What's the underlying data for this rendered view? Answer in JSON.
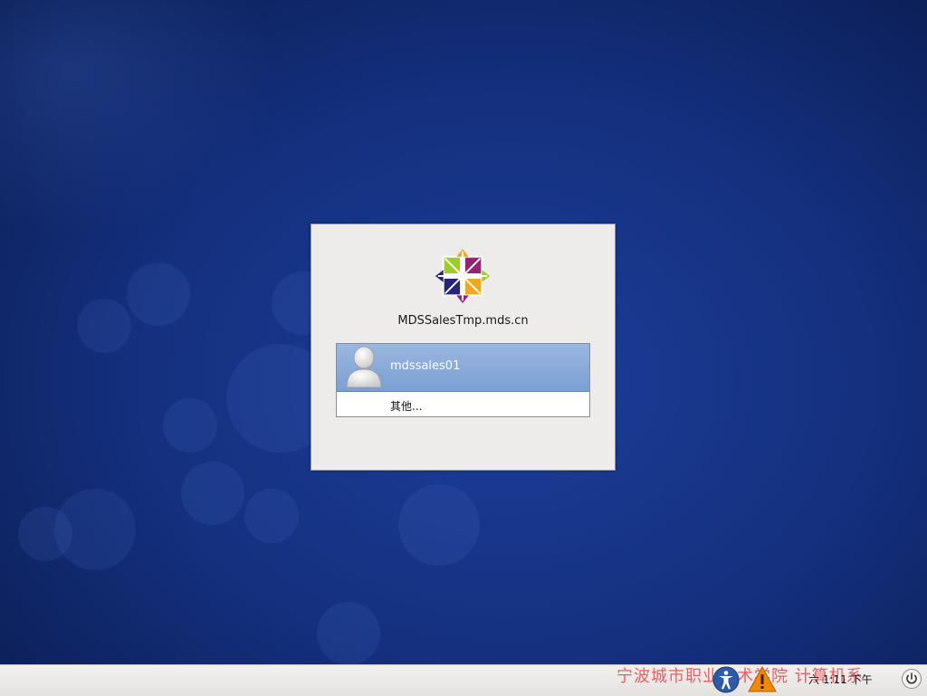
{
  "login": {
    "hostname": "MDSSalesTmp.mds.cn",
    "users": [
      {
        "name": "mdssales01",
        "icon": "user-avatar-icon"
      }
    ],
    "other_label": "其他..."
  },
  "panel": {
    "clock": "六 1:11 下午",
    "icons": [
      "accessibility-icon",
      "warning-icon",
      "power-icon"
    ]
  },
  "watermark": "宁波城市职业技术学院 计算机系",
  "colors": {
    "desktop_bg": "#14307e",
    "dialog_bg": "#edeceb",
    "selection": "#7a9fd3",
    "panel_bg": "#e8e6e3",
    "warning": "#f08a00"
  }
}
